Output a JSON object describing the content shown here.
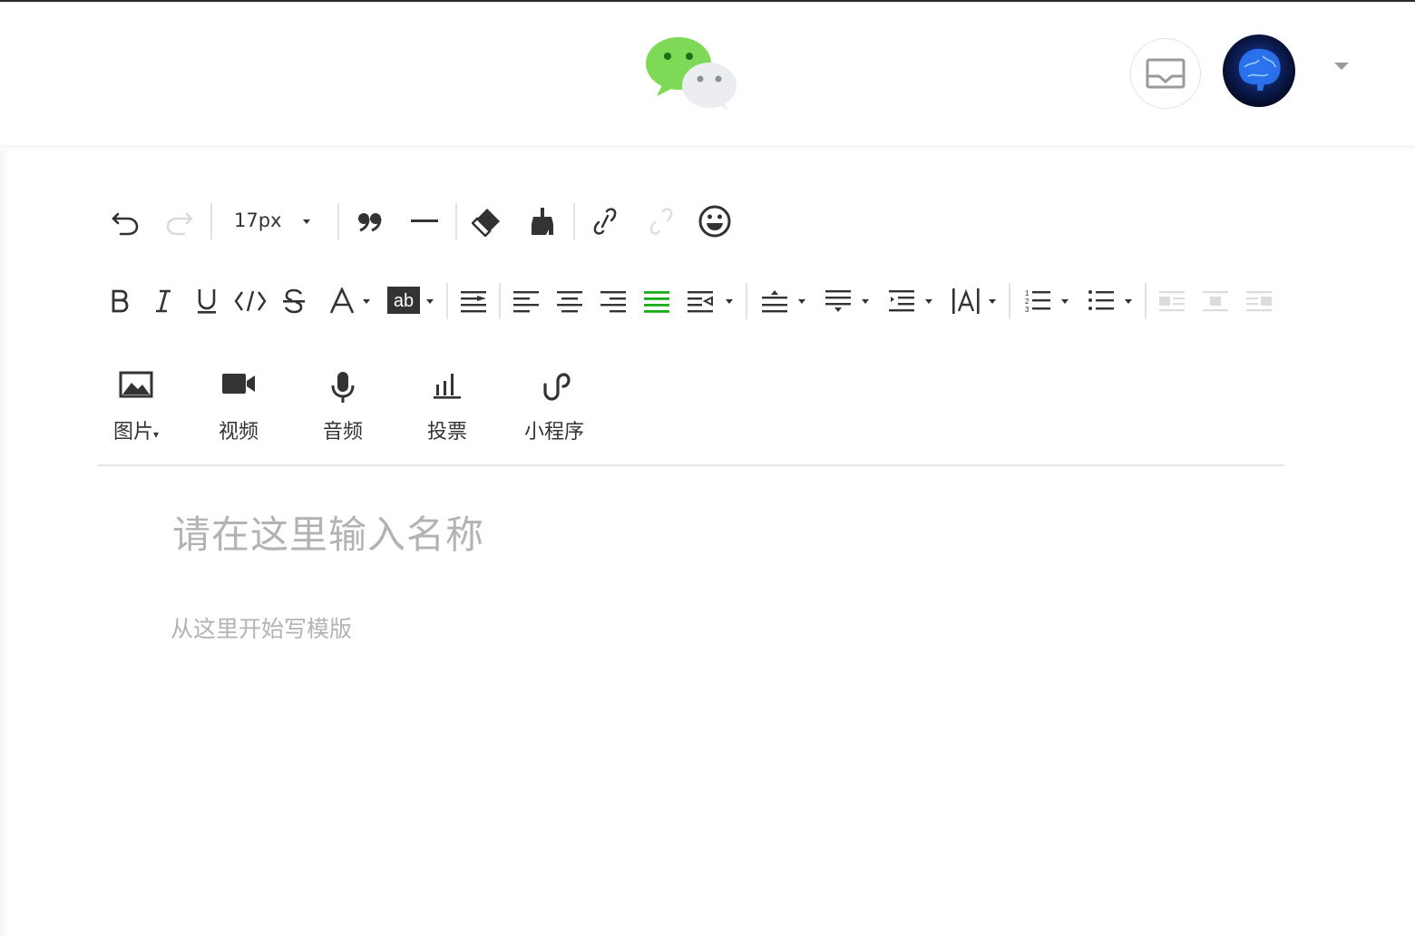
{
  "header": {
    "logo_name": "wechat-logo",
    "mail_icon": "mail-icon",
    "avatar_image": "brain-avatar"
  },
  "toolbar": {
    "font_size": "17px",
    "colors": {
      "icon": "#333333",
      "disabled": "#d9d9d9",
      "active": "#1aad19"
    }
  },
  "media": {
    "image_label": "图片",
    "video_label": "视频",
    "audio_label": "音频",
    "vote_label": "投票",
    "miniprogram_label": "小程序"
  },
  "editor": {
    "title_placeholder": "请在这里输入名称",
    "body_placeholder": "从这里开始写模版"
  }
}
